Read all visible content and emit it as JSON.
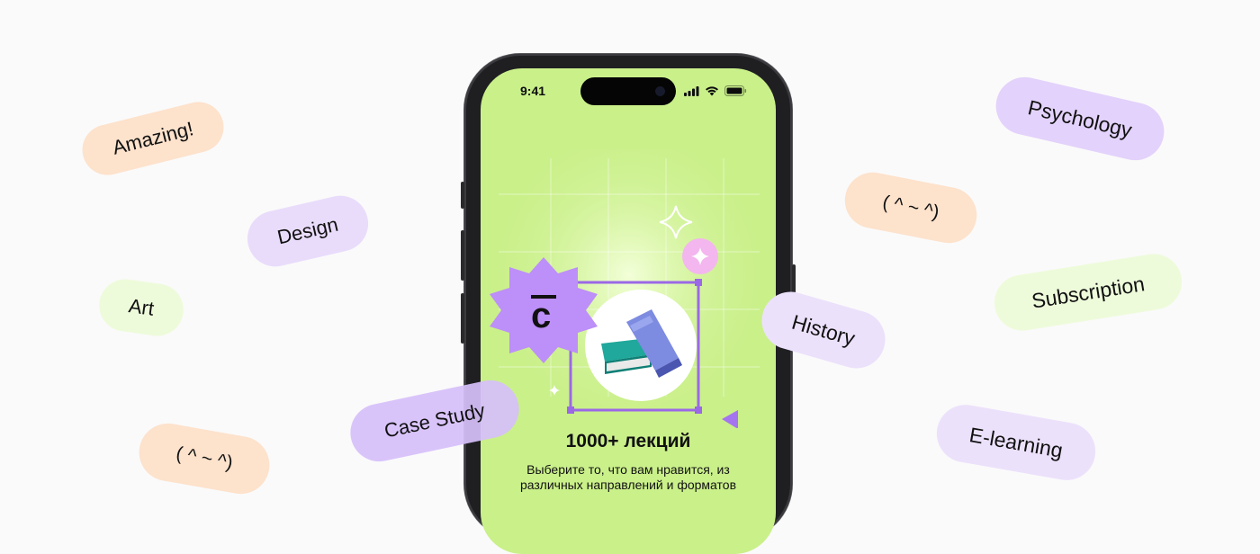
{
  "phone": {
    "status_time": "9:41",
    "title": "1000+ лекций",
    "subtitle_line1": "Выберите то, что вам нравится, из",
    "subtitle_line2": "различных направлений и форматов",
    "logo_letter": "с"
  },
  "tags": {
    "amazing": "Amazing!",
    "design": "Design",
    "art": "Art",
    "kaomoji_left": "( ^ ~ ^)",
    "case_study": "Case Study",
    "psychology": "Psychology",
    "kaomoji_right": "( ^ ~ ^)",
    "subscription": "Subscription",
    "history": "History",
    "elearning": "E-learning"
  },
  "colors": {
    "screen_green": "#caf08a",
    "purple": "#bd8ff8",
    "lavender_pill": "#e8dbfb",
    "peach_pill": "#fde3cf",
    "mint_pill": "#eefbdc"
  }
}
